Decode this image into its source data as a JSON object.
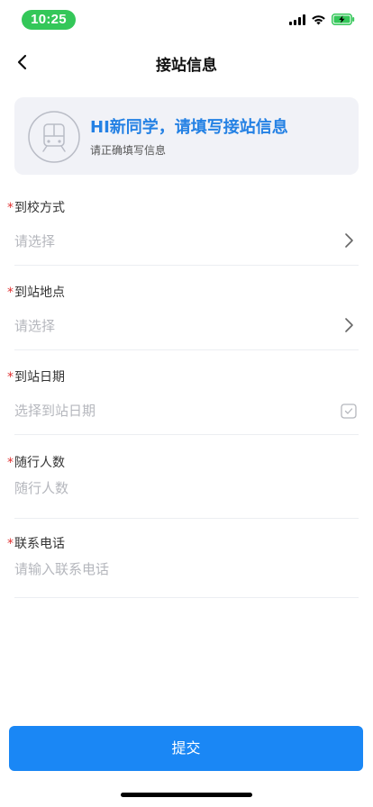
{
  "status_bar": {
    "time": "10:25",
    "accent_color": "#34c759",
    "icons": [
      "signal-icon",
      "wifi-icon",
      "battery-charging-icon"
    ]
  },
  "nav": {
    "title": "接站信息",
    "back_icon": "chevron-left-icon"
  },
  "banner": {
    "title": "HI新同学，请填写接站信息",
    "subtitle": "请正确填写信息",
    "icon": "train-icon",
    "title_color": "#2481e4"
  },
  "form": {
    "required_mark": "*",
    "fields": [
      {
        "label": "到校方式",
        "placeholder": "请选择",
        "icon": "chevron-right-icon"
      },
      {
        "label": "到站地点",
        "placeholder": "请选择",
        "icon": "chevron-right-icon"
      },
      {
        "label": "到站日期",
        "placeholder": "选择到站日期",
        "icon": "calendar-icon"
      },
      {
        "label": "随行人数",
        "placeholder": "随行人数"
      },
      {
        "label": "联系电话",
        "placeholder": "请输入联系电话"
      }
    ]
  },
  "submit": {
    "label": "提交",
    "color": "#1a87f5"
  }
}
